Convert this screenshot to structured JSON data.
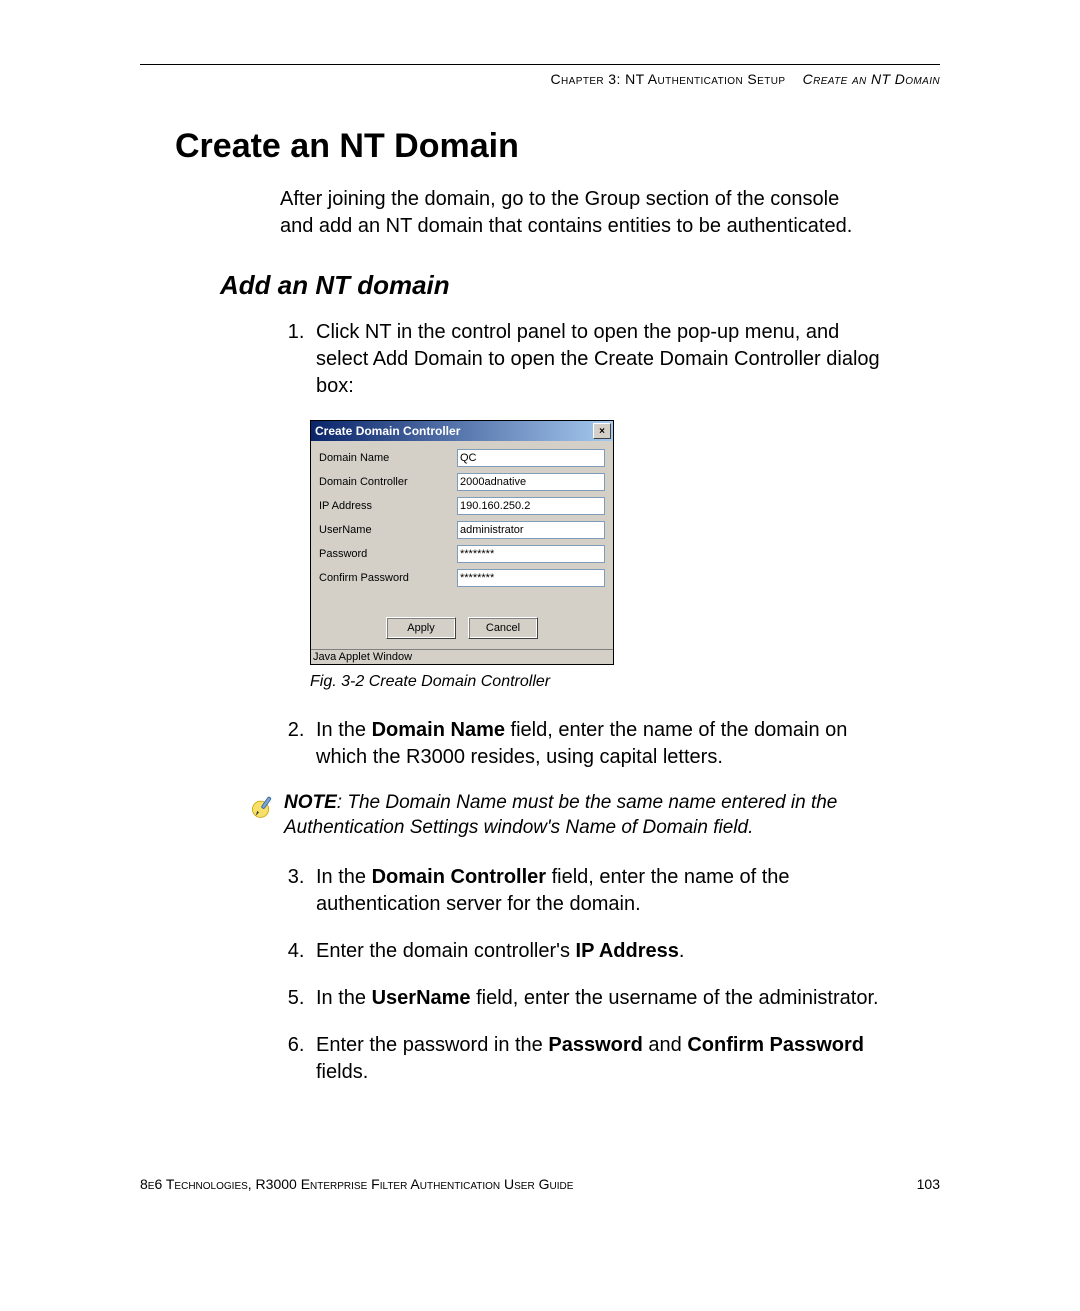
{
  "header": {
    "chapter": "Chapter 3: NT Authentication Setup",
    "section": "Create an NT Domain"
  },
  "title": "Create an NT Domain",
  "intro": "After joining the domain, go to the Group section of the console and add an NT domain that contains entities to be authenticated.",
  "subsection": "Add an NT domain",
  "steps": {
    "s1": "Click NT in the control panel to open the pop-up menu, and select Add Domain to open the Create Domain Controller dialog box:",
    "s2_pre": "In the ",
    "s2_bold": "Domain Name",
    "s2_post": " field, enter the name of the domain on which the R3000 resides, using capital letters.",
    "s3_pre": "In the ",
    "s3_bold": "Domain Controller",
    "s3_post": " field, enter the name of the authentication server for the domain.",
    "s4_pre": "Enter the domain controller's ",
    "s4_bold": "IP Address",
    "s4_post": ".",
    "s5_pre": "In the ",
    "s5_bold": "UserName",
    "s5_post": " field, enter the username of the administrator.",
    "s6_pre": "Enter the password in the ",
    "s6_bold1": "Password",
    "s6_mid": " and ",
    "s6_bold2": "Confirm Password",
    "s6_post": " fields."
  },
  "dialog": {
    "title": "Create Domain Controller",
    "close": "×",
    "labels": {
      "domain_name": "Domain Name",
      "domain_controller": "Domain Controller",
      "ip": "IP Address",
      "user": "UserName",
      "pass": "Password",
      "confirm": "Confirm Password"
    },
    "values": {
      "domain_name": "QC",
      "domain_controller": "2000adnative",
      "ip": "190.160.250.2",
      "user": "administrator",
      "pass": "********",
      "confirm": "********"
    },
    "buttons": {
      "apply": "Apply",
      "cancel": "Cancel"
    },
    "status": "Java Applet Window"
  },
  "figure_caption": "Fig. 3-2  Create Domain Controller",
  "note": {
    "label": "NOTE",
    "text": ": The Domain Name must be the same name entered in the Authentication Settings window's Name of Domain field."
  },
  "footer": {
    "left": "8e6 Technologies, R3000 Enterprise Filter Authentication User Guide",
    "page": "103"
  }
}
